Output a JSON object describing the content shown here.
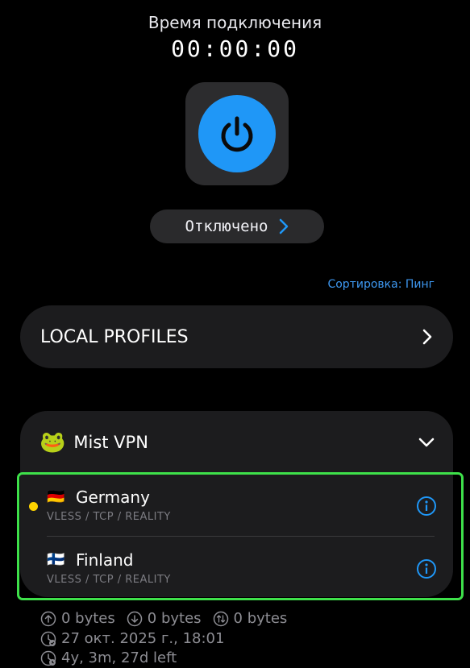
{
  "timer": {
    "title": "Время подключения",
    "value": "00:00:00"
  },
  "status": {
    "label": "Отключено"
  },
  "sort": {
    "label": "Сортировка: Пинг"
  },
  "local_profiles": {
    "label": "LOCAL PROFILES"
  },
  "subscription": {
    "emoji": "🐸",
    "name": "Mist VPN",
    "servers": [
      {
        "flag": "🇩🇪",
        "name": "Germany",
        "protocol": "VLESS / TCP / REALITY",
        "active": true
      },
      {
        "flag": "🇫🇮",
        "name": "Finland",
        "protocol": "VLESS / TCP / REALITY",
        "active": false
      }
    ]
  },
  "traffic": {
    "upload": "0 bytes",
    "download": "0 bytes",
    "total": "0 bytes"
  },
  "updated": "27 окт. 2025 г., 18:01",
  "expires": "4y, 3m, 27d left",
  "colors": {
    "accent": "#1f97f7",
    "link": "#3e98f1",
    "highlight": "#3ee04a",
    "active_dot": "#ffd400"
  }
}
